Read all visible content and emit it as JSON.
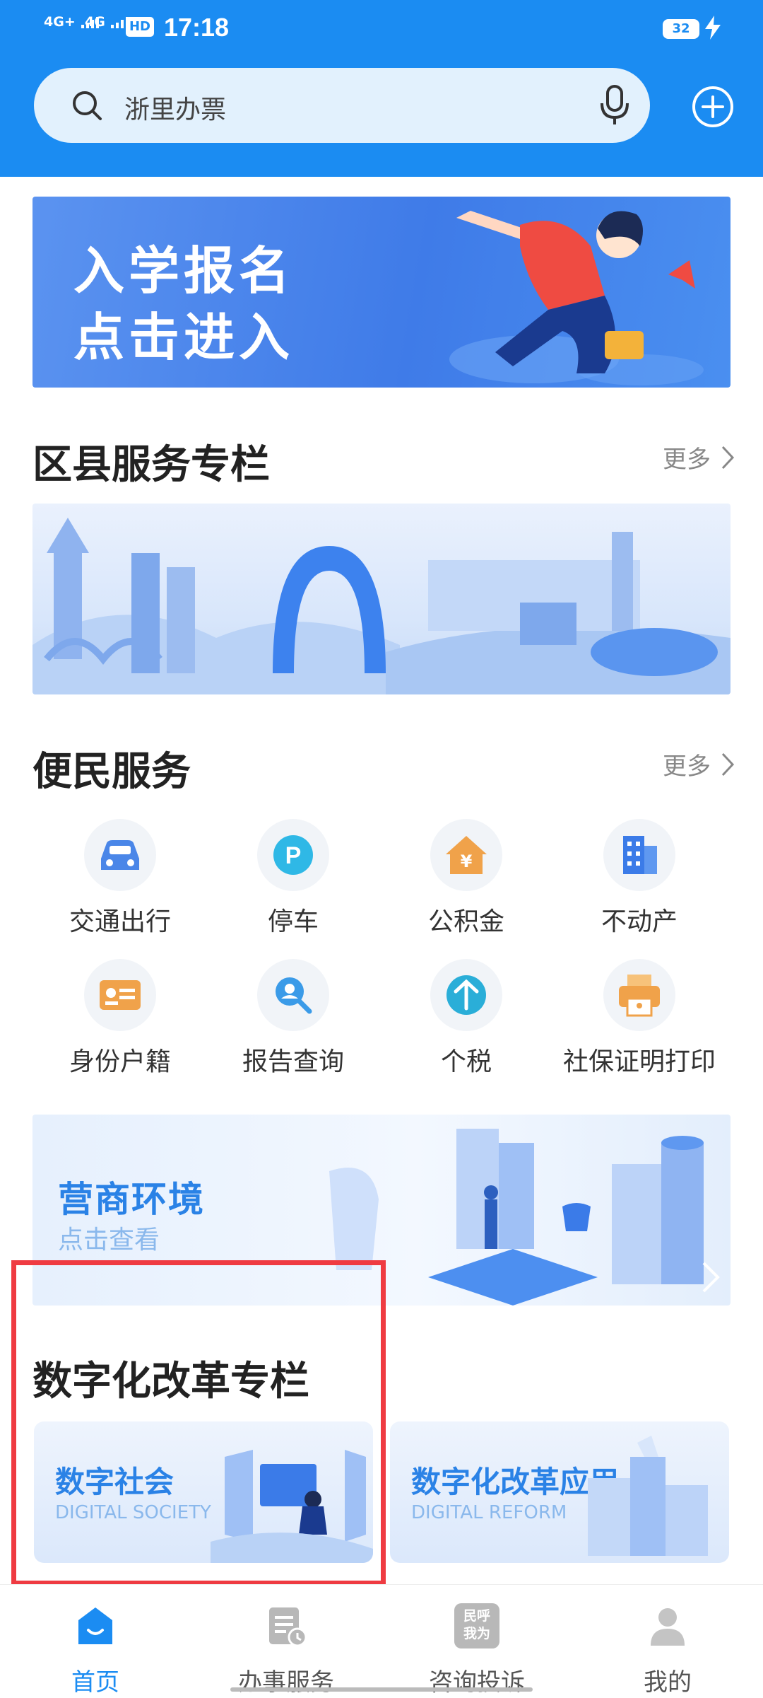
{
  "status_bar": {
    "signal1": "4G+",
    "signal2": "4G",
    "hd": "HD",
    "time": "17:18",
    "battery": "32"
  },
  "search": {
    "placeholder": "浙里办票"
  },
  "banner_enroll": {
    "line1": "入学报名",
    "line2": "点击进入"
  },
  "section_district": {
    "title": "区县服务专栏",
    "more": "更多"
  },
  "section_convenience": {
    "title": "便民服务",
    "more": "更多",
    "items": [
      {
        "label": "交通出行",
        "icon": "car-icon",
        "color": "#4a86e8"
      },
      {
        "label": "停车",
        "icon": "parking-icon",
        "color": "#2fb8e6"
      },
      {
        "label": "公积金",
        "icon": "house-fund-icon",
        "color": "#f0a24a"
      },
      {
        "label": "不动产",
        "icon": "building-icon",
        "color": "#3b7be8"
      },
      {
        "label": "身份户籍",
        "icon": "id-card-icon",
        "color": "#f0a24a"
      },
      {
        "label": "报告查询",
        "icon": "report-search-icon",
        "color": "#3b9be8"
      },
      {
        "label": "个税",
        "icon": "tax-icon",
        "color": "#2aaed8"
      },
      {
        "label": "社保证明打印",
        "icon": "printer-icon",
        "color": "#f0a24a"
      }
    ]
  },
  "banner_business": {
    "title": "营商环境",
    "subtitle": "点击查看"
  },
  "section_digital": {
    "title": "数字化改革专栏",
    "cards": [
      {
        "title": "数字社会",
        "subtitle": "DIGITAL SOCIETY"
      },
      {
        "title": "数字化改革应用",
        "subtitle": "DIGITAL REFORM"
      }
    ]
  },
  "bottom_nav": {
    "tabs": [
      {
        "label": "首页",
        "active": true
      },
      {
        "label": "办事服务",
        "active": false
      },
      {
        "label": "咨询投诉",
        "active": false
      },
      {
        "label": "我的",
        "active": false
      }
    ],
    "badge_text": "民呼我为"
  },
  "colors": {
    "brand": "#1b8cf2",
    "accent_text": "#2a82e6",
    "highlight_border": "#ef3b42"
  }
}
